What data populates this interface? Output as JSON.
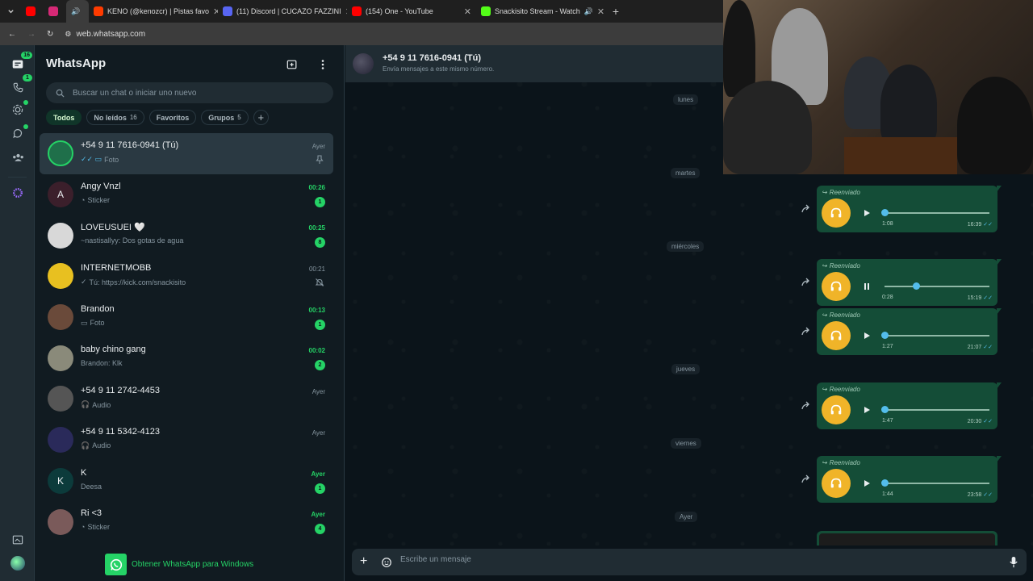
{
  "browser": {
    "tabs": [
      {
        "title": "",
        "color": "#ff0000"
      },
      {
        "title": "",
        "color": "#d62976"
      },
      {
        "title": "",
        "color": "#444"
      },
      {
        "title": "KENO (@kenozcr) | Pistas favo",
        "color": "#ff3b00"
      },
      {
        "title": "(11) Discord | CUCAZO FAZZINI",
        "color": "#5865f2"
      },
      {
        "title": "(154) One - YouTube",
        "color": "#ff0000"
      },
      {
        "title": "Snackisito Stream - Watch",
        "color": "#53fc18"
      }
    ],
    "url": "web.whatsapp.com"
  },
  "rail": {
    "chats_badge": "16",
    "calls_badge": "1"
  },
  "sidebar": {
    "title": "WhatsApp",
    "search_placeholder": "Buscar un chat o iniciar uno nuevo",
    "filters": [
      {
        "label": "Todos",
        "count": ""
      },
      {
        "label": "No leídos",
        "count": "16"
      },
      {
        "label": "Favoritos",
        "count": ""
      },
      {
        "label": "Grupos",
        "count": "5"
      }
    ],
    "chats": [
      {
        "name": "+54 9 11 7616-0941 (Tú)",
        "preview": "Foto",
        "time": "Ayer",
        "unread": "",
        "avatar": "",
        "avatar_color": "#1f6f4a",
        "prefix": "✓✓ ▭",
        "right_icon": "pin-icon",
        "selected": true,
        "green": false
      },
      {
        "name": "Angy Vnzl",
        "preview": "Sticker",
        "time": "00:26",
        "unread": "1",
        "avatar": "A",
        "avatar_color": "#3b1f2b",
        "prefix": "◔",
        "right_icon": "",
        "selected": false,
        "green": true
      },
      {
        "name": "LOVEUSUEI 🤍",
        "preview": "~nastisallyy: Dos gotas de agua",
        "time": "00:25",
        "unread": "8",
        "avatar": "",
        "avatar_color": "#d8d8d8",
        "prefix": "",
        "right_icon": "",
        "selected": false,
        "green": true
      },
      {
        "name": "INTERNETMOBB",
        "preview": "Tú: https://kick.com/snackisito",
        "time": "00:21",
        "unread": "",
        "avatar": "",
        "avatar_color": "#e8c020",
        "prefix": "✓",
        "right_icon": "mute-icon",
        "selected": false,
        "green": false
      },
      {
        "name": "Brandon",
        "preview": "Foto",
        "time": "00:13",
        "unread": "1",
        "avatar": "",
        "avatar_color": "#6a4a3a",
        "prefix": "▭",
        "right_icon": "",
        "selected": false,
        "green": true
      },
      {
        "name": "baby chino gang",
        "preview": "Brandon: Klk",
        "time": "00:02",
        "unread": "2",
        "avatar": "",
        "avatar_color": "#8a8a7a",
        "prefix": "",
        "right_icon": "",
        "selected": false,
        "green": true
      },
      {
        "name": "+54 9 11 2742-4453",
        "preview": "Audio",
        "time": "Ayer",
        "unread": "",
        "avatar": "",
        "avatar_color": "#555",
        "prefix": "🎧",
        "right_icon": "",
        "selected": false,
        "green": false
      },
      {
        "name": "+54 9 11 5342-4123",
        "preview": "Audio",
        "time": "Ayer",
        "unread": "",
        "avatar": "",
        "avatar_color": "#2a2a5a",
        "prefix": "🎧",
        "right_icon": "",
        "selected": false,
        "green": false
      },
      {
        "name": "K",
        "preview": "Deesa",
        "time": "Ayer",
        "unread": "1",
        "avatar": "K",
        "avatar_color": "#0c3b3b",
        "prefix": "",
        "right_icon": "",
        "selected": false,
        "green": true
      },
      {
        "name": "Ri <3",
        "preview": "Sticker",
        "time": "Ayer",
        "unread": "4",
        "avatar": "",
        "avatar_color": "#7a5a5a",
        "prefix": "◔",
        "right_icon": "",
        "selected": false,
        "green": true
      }
    ],
    "get_app_label": "Obtener WhatsApp para Windows"
  },
  "chat": {
    "title": "+54 9 11 7616-0941 (Tú)",
    "subtitle": "Envía mensajes a este mismo número.",
    "days": [
      "lunes",
      "martes",
      "miércoles",
      "jueves",
      "viernes",
      "Ayer"
    ],
    "forwarded_label": "Reenviado",
    "audio_messages": [
      {
        "duration": "1:08",
        "time": "16:39",
        "progress": 0,
        "playing": false
      },
      {
        "duration": "0:28",
        "time": "15:19",
        "progress": 0.3,
        "playing": true
      },
      {
        "duration": "1:27",
        "time": "21:07",
        "progress": 0,
        "playing": false
      },
      {
        "duration": "1:47",
        "time": "20:30",
        "progress": 0,
        "playing": false
      },
      {
        "duration": "1:44",
        "time": "23:58",
        "progress": 0,
        "playing": false
      }
    ],
    "composer_placeholder": "Escribe un mensaje"
  }
}
